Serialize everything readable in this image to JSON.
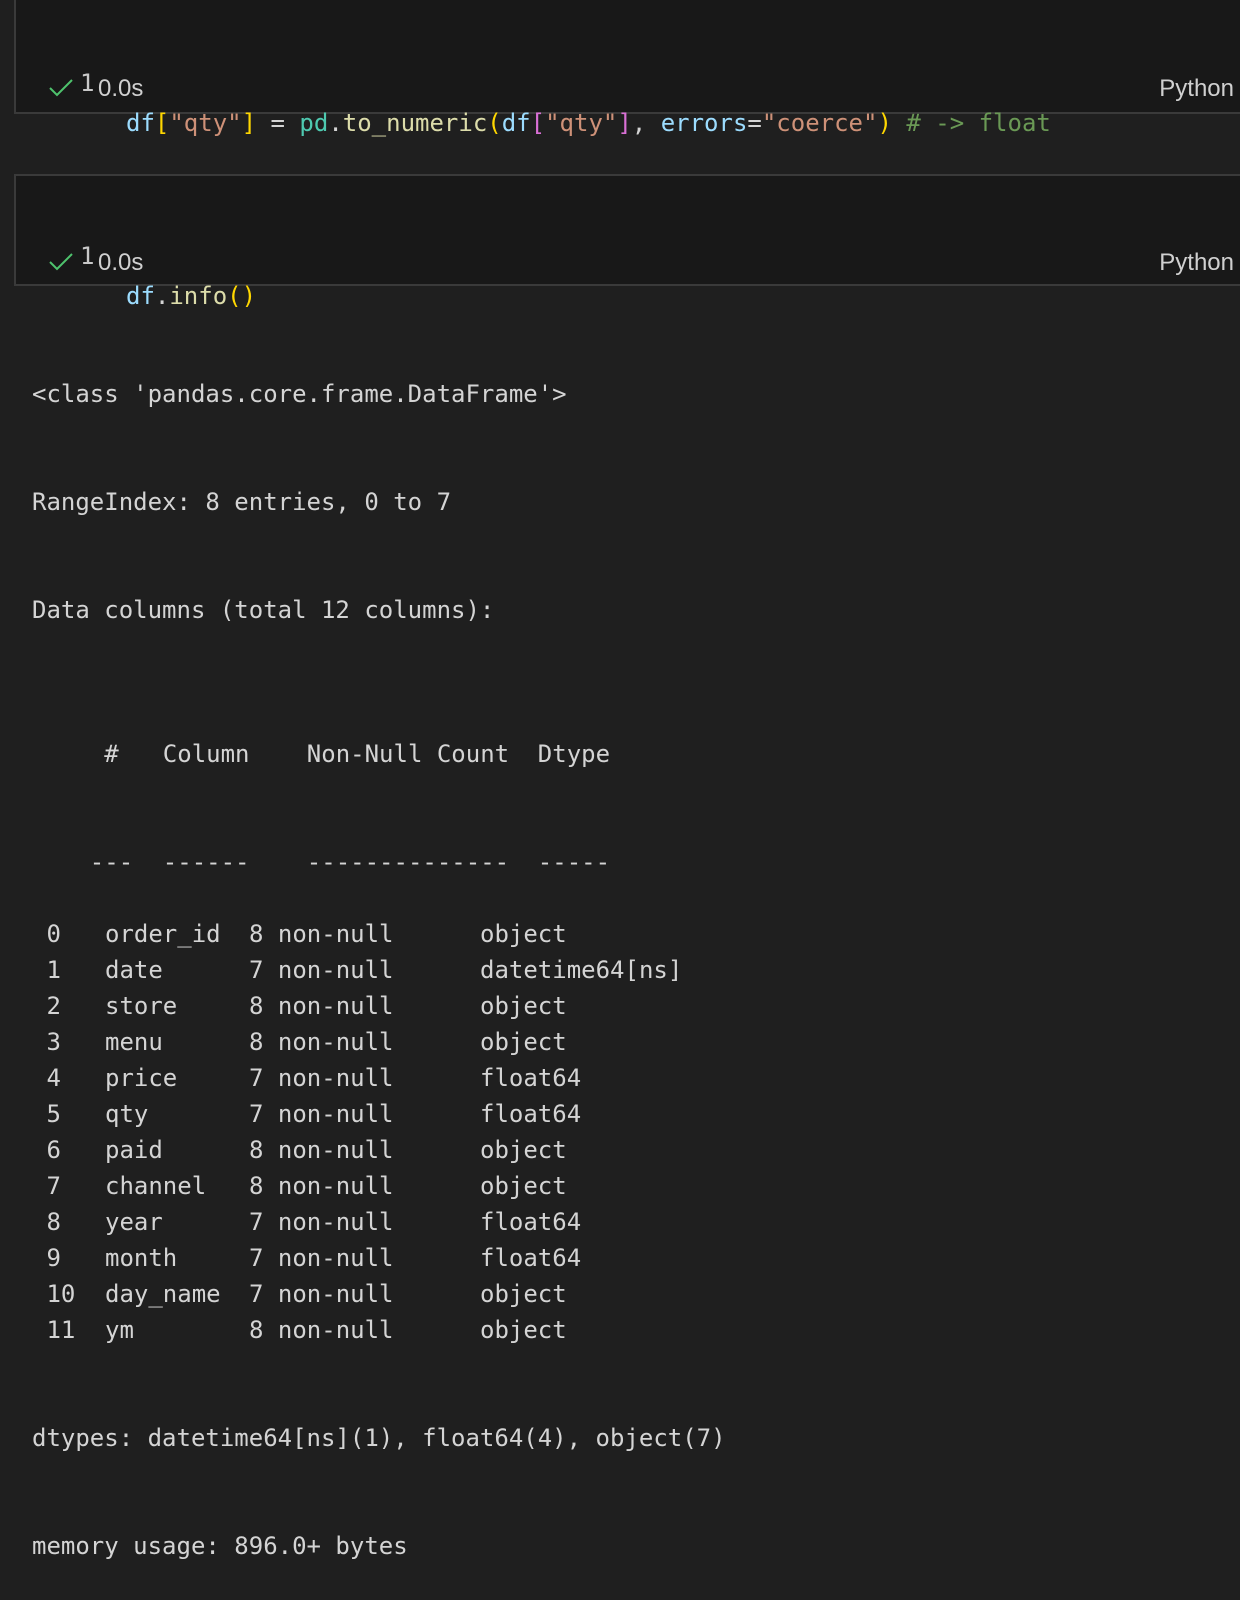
{
  "cells": [
    {
      "line_number": "1",
      "code_tokens": [
        {
          "text": "df",
          "cls": "t-var"
        },
        {
          "text": "[",
          "cls": "t-br1"
        },
        {
          "text": "\"qty\"",
          "cls": "t-str"
        },
        {
          "text": "]",
          "cls": "t-br1"
        },
        {
          "text": " = ",
          "cls": "t-op"
        },
        {
          "text": "pd",
          "cls": "t-ns"
        },
        {
          "text": ".",
          "cls": "t-op"
        },
        {
          "text": "to_numeric",
          "cls": "t-fn"
        },
        {
          "text": "(",
          "cls": "t-br1"
        },
        {
          "text": "df",
          "cls": "t-var"
        },
        {
          "text": "[",
          "cls": "t-br2"
        },
        {
          "text": "\"qty\"",
          "cls": "t-str"
        },
        {
          "text": "]",
          "cls": "t-br2"
        },
        {
          "text": ", ",
          "cls": "t-op"
        },
        {
          "text": "errors",
          "cls": "t-var"
        },
        {
          "text": "=",
          "cls": "t-op"
        },
        {
          "text": "\"coerce\"",
          "cls": "t-str"
        },
        {
          "text": ")",
          "cls": "t-br1"
        },
        {
          "text": " # -> float",
          "cls": "t-cmt"
        }
      ],
      "status_time": "0.0s",
      "language": "Python"
    },
    {
      "line_number": "1",
      "code_tokens": [
        {
          "text": "df",
          "cls": "t-var"
        },
        {
          "text": ".",
          "cls": "t-op"
        },
        {
          "text": "info",
          "cls": "t-fn"
        },
        {
          "text": "()",
          "cls": "t-br1"
        }
      ],
      "status_time": "0.0s",
      "language": "Python"
    }
  ],
  "output": {
    "header_lines": [
      "<class 'pandas.core.frame.DataFrame'>",
      "RangeIndex: 8 entries, 0 to 7",
      "Data columns (total 12 columns):"
    ],
    "table_header": [
      " #",
      "Column",
      "Non-Null Count",
      "Dtype"
    ],
    "table_rule": [
      "---",
      "------",
      "--------------",
      "-----"
    ],
    "rows": [
      [
        " 0",
        "order_id",
        "8 non-null",
        "object"
      ],
      [
        " 1",
        "date",
        "7 non-null",
        "datetime64[ns]"
      ],
      [
        " 2",
        "store",
        "8 non-null",
        "object"
      ],
      [
        " 3",
        "menu",
        "8 non-null",
        "object"
      ],
      [
        " 4",
        "price",
        "7 non-null",
        "float64"
      ],
      [
        " 5",
        "qty",
        "7 non-null",
        "float64"
      ],
      [
        " 6",
        "paid",
        "8 non-null",
        "object"
      ],
      [
        " 7",
        "channel",
        "8 non-null",
        "object"
      ],
      [
        " 8",
        "year",
        "7 non-null",
        "float64"
      ],
      [
        " 9",
        "month",
        "7 non-null",
        "float64"
      ],
      [
        " 10",
        "day_name",
        "7 non-null",
        "object"
      ],
      [
        " 11",
        "ym",
        "8 non-null",
        "object"
      ]
    ],
    "footer_lines": [
      "dtypes: datetime64[ns](1), float64(4), object(7)",
      "memory usage: 896.0+ bytes"
    ]
  },
  "colors": {
    "background": "#1f1f1f",
    "cell_background": "#181818",
    "check": "#4ec36d"
  }
}
